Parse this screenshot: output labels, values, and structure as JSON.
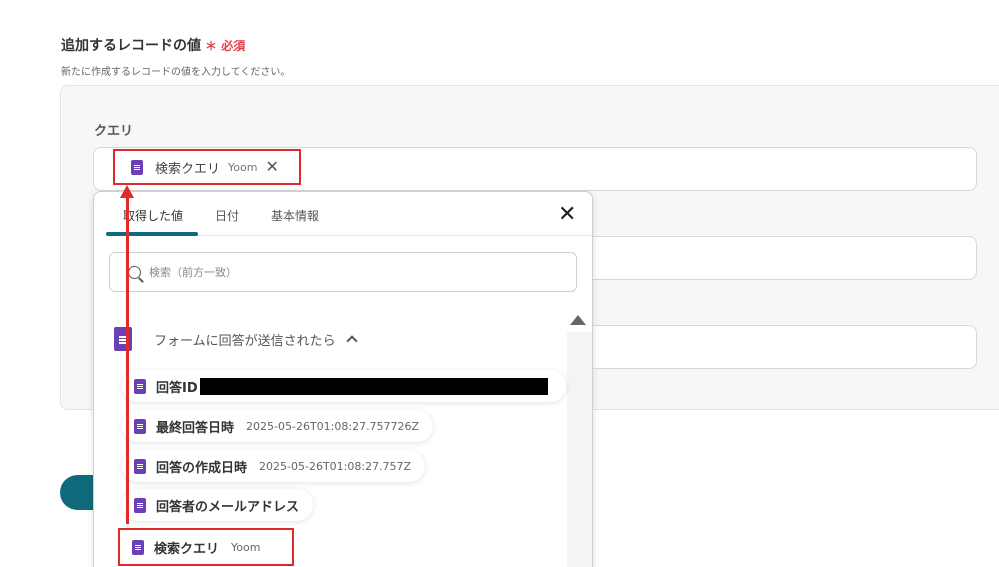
{
  "section": {
    "title": "追加するレコードの値",
    "required_mark": "＊",
    "required_label": "必須",
    "description": "新たに作成するレコードの値を入力してください。"
  },
  "field": {
    "label": "クエリ"
  },
  "selected_tag": {
    "label": "検索クエリ",
    "source": "Yoom",
    "close": "✕"
  },
  "dropdown": {
    "tabs": [
      {
        "label": "取得した値",
        "active": true
      },
      {
        "label": "日付",
        "active": false
      },
      {
        "label": "基本情報",
        "active": false
      }
    ],
    "close": "✕",
    "search_placeholder": "検索（前方一致）",
    "group": {
      "label": "フォームに回答が送信されたら"
    },
    "items": [
      {
        "label": "回答ID",
        "value": ""
      },
      {
        "label": "最終回答日時",
        "value": "2025-05-26T01:08:27.757726Z"
      },
      {
        "label": "回答の作成日時",
        "value": "2025-05-26T01:08:27.757Z"
      },
      {
        "label": "回答者のメールアドレス",
        "value": ""
      },
      {
        "label": "検索クエリ",
        "value": "Yoom"
      }
    ]
  },
  "colors": {
    "accent": "#0f6b7c",
    "highlight": "#e02a2a",
    "forms_icon": "#6b3fb8",
    "required": "#e0404a"
  }
}
